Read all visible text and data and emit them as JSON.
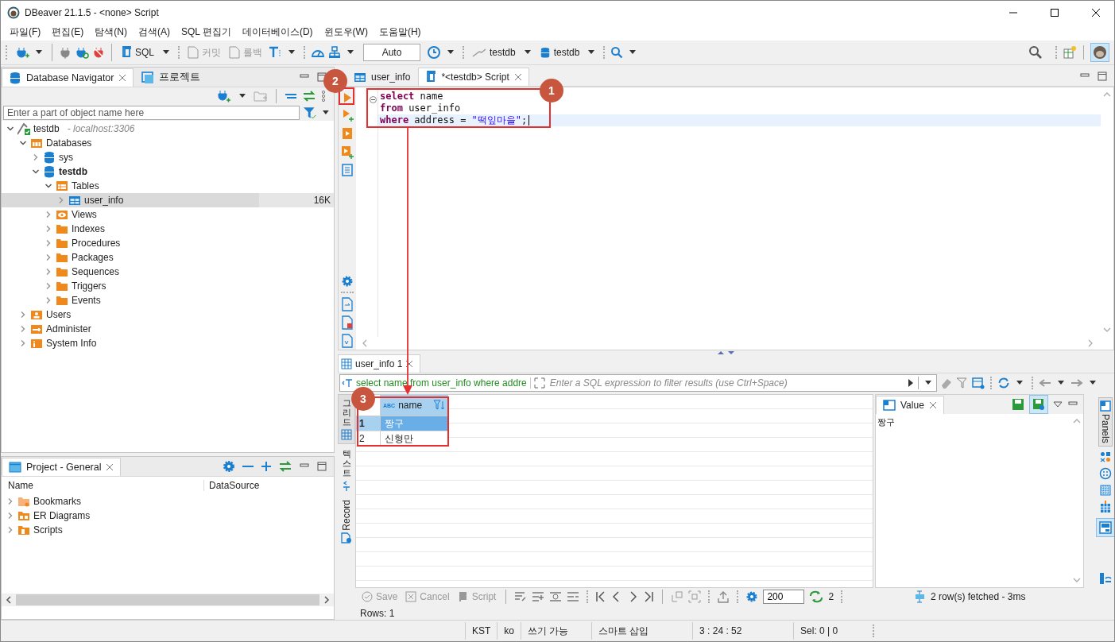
{
  "window": {
    "title": "DBeaver 21.1.5 - <none> Script"
  },
  "menu": [
    "파일(F)",
    "편집(E)",
    "탐색(N)",
    "검색(A)",
    "SQL 편집기",
    "데이터베이스(D)",
    "윈도우(W)",
    "도움말(H)"
  ],
  "toolbar": {
    "sql": "SQL",
    "commit": {
      "label": "커밋",
      "disabled": true
    },
    "rollback": {
      "label": "롤백",
      "disabled": true
    },
    "transaction_mode": "Auto",
    "datasource": "testdb",
    "schema": "testdb"
  },
  "navigator": {
    "tabs": [
      {
        "label": "Database Navigator",
        "selected": true
      },
      {
        "label": "프로젝트",
        "selected": false
      }
    ],
    "search": {
      "placeholder": "Enter a part of object name here"
    },
    "tree": [
      {
        "label": "testdb",
        "note": "- localhost:3306",
        "kind": "connection",
        "expanded": true,
        "selected": false,
        "active": false,
        "children": [
          {
            "label": "Databases",
            "kind": "databases",
            "expanded": true,
            "selected": false,
            "active": false,
            "children": [
              {
                "label": "sys",
                "kind": "db",
                "expanded": false,
                "selected": false,
                "active": false
              },
              {
                "label": "testdb",
                "kind": "db",
                "expanded": true,
                "selected": false,
                "active": true,
                "children": [
                  {
                    "label": "Tables",
                    "kind": "tables",
                    "expanded": true,
                    "selected": false,
                    "active": false,
                    "children": [
                      {
                        "label": "user_info",
                        "kind": "table",
                        "size": "16K",
                        "expanded": false,
                        "selected": true,
                        "active": false
                      }
                    ]
                  },
                  {
                    "label": "Views",
                    "kind": "views",
                    "expanded": false,
                    "selected": false,
                    "active": false
                  },
                  {
                    "label": "Indexes",
                    "kind": "folder",
                    "expanded": false,
                    "selected": false,
                    "active": false
                  },
                  {
                    "label": "Procedures",
                    "kind": "folder",
                    "expanded": false,
                    "selected": false,
                    "active": false
                  },
                  {
                    "label": "Packages",
                    "kind": "folder",
                    "expanded": false,
                    "selected": false,
                    "active": false
                  },
                  {
                    "label": "Sequences",
                    "kind": "folder",
                    "expanded": false,
                    "selected": false,
                    "active": false
                  },
                  {
                    "label": "Triggers",
                    "kind": "folder",
                    "expanded": false,
                    "selected": false,
                    "active": false
                  },
                  {
                    "label": "Events",
                    "kind": "folder",
                    "expanded": false,
                    "selected": false,
                    "active": false
                  }
                ]
              }
            ]
          },
          {
            "label": "Users",
            "kind": "users",
            "expanded": false,
            "selected": false,
            "active": false
          },
          {
            "label": "Administer",
            "kind": "administer",
            "expanded": false,
            "selected": false,
            "active": false
          },
          {
            "label": "System Info",
            "kind": "info",
            "expanded": false,
            "selected": false,
            "active": false
          }
        ]
      }
    ]
  },
  "project": {
    "tab": "Project - General",
    "columns": [
      "Name",
      "DataSource"
    ],
    "items": [
      {
        "label": "Bookmarks",
        "kind": "bookmarks",
        "expanded": false
      },
      {
        "label": "ER Diagrams",
        "kind": "diagrams",
        "expanded": false
      },
      {
        "label": "Scripts",
        "kind": "scripts",
        "expanded": false
      }
    ]
  },
  "editor": {
    "tabs": [
      {
        "label": "user_info",
        "kind": "table",
        "selected": false
      },
      {
        "label": "*<testdb> Script",
        "kind": "script",
        "selected": true
      }
    ],
    "lines": [
      {
        "current": false,
        "segments": [
          {
            "text": "select",
            "kind": "keyword"
          },
          {
            "text": " name",
            "kind": "plain"
          }
        ]
      },
      {
        "current": false,
        "segments": [
          {
            "text": "from",
            "kind": "keyword"
          },
          {
            "text": " user_info",
            "kind": "plain"
          }
        ]
      },
      {
        "current": true,
        "segments": [
          {
            "text": "where",
            "kind": "keyword"
          },
          {
            "text": " address = ",
            "kind": "plain"
          },
          {
            "text": "\"떡잎마을\"",
            "kind": "string"
          },
          {
            "text": ";",
            "kind": "plain"
          }
        ]
      }
    ]
  },
  "results": {
    "tab": "user_info 1",
    "query": "select name from user_info where addre",
    "filter_placeholder": "Enter a SQL expression to filter results (use Ctrl+Space)",
    "side_tabs": [
      {
        "label": "그리드",
        "kind": "grid",
        "selected": true
      },
      {
        "label": "텍스트",
        "kind": "text",
        "selected": false
      },
      {
        "label": "Record",
        "kind": "record",
        "selected": false
      }
    ],
    "column": {
      "type_badge": "ABC",
      "name": "name"
    },
    "rows": [
      {
        "number": "1",
        "name": "짱구",
        "selected": true
      },
      {
        "number": "2",
        "name": "신형만",
        "selected": false
      }
    ],
    "value_panel": {
      "tab": "Value",
      "content": "짱구"
    },
    "panels_tab": "Panels",
    "actions": [
      {
        "label": "Save",
        "disabled": true
      },
      {
        "label": "Cancel",
        "disabled": true
      },
      {
        "label": "Script",
        "disabled": true
      }
    ],
    "fetch_size": "200",
    "refresh_count": "2",
    "status": "2 row(s) fetched - 3ms",
    "rows_info": "Rows: 1"
  },
  "status_bar": [
    "KST",
    "ko",
    "쓰기 가능",
    "스마트 삽입",
    "3 : 24 : 52",
    "Sel: 0 | 0"
  ],
  "annotations": [
    {
      "label": "1"
    },
    {
      "label": "2"
    },
    {
      "label": "3"
    }
  ]
}
